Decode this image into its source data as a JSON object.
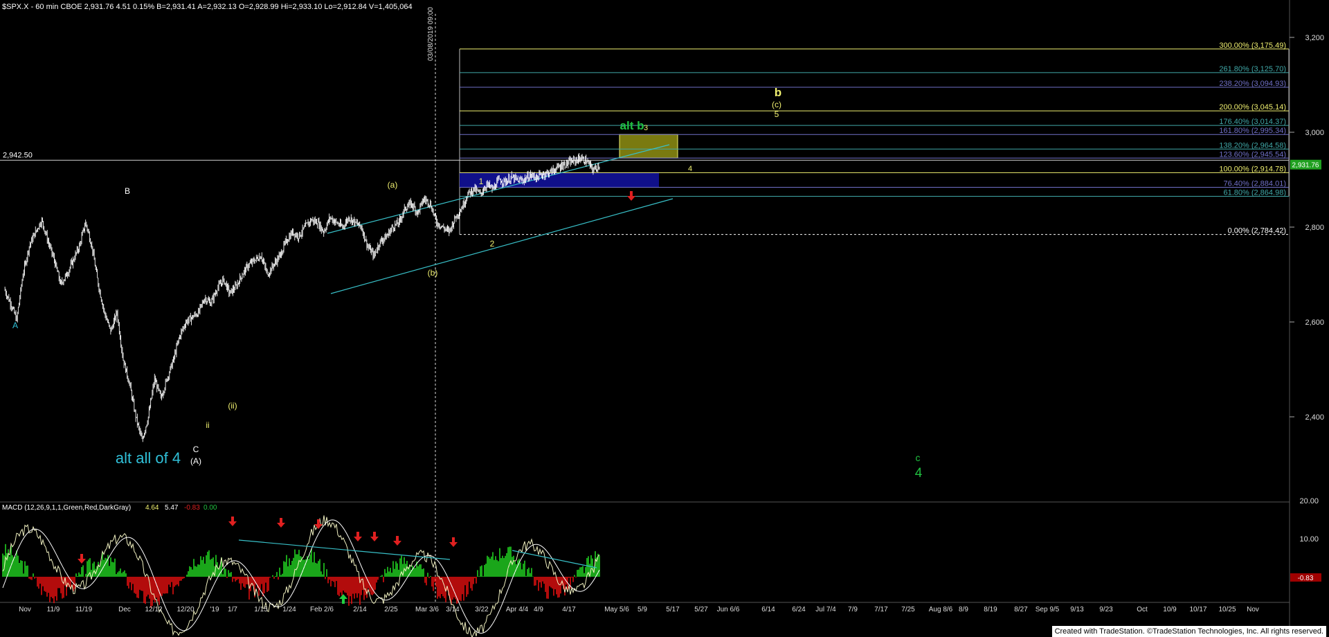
{
  "header": {
    "text": "$SPX.X - 60 min  CBOE  2,931.76  4.51  0.15%  B=2,931.41  A=2,932.13  O=2,928.99  Hi=2,933.10  Lo=2,912.84  V=1,405,064"
  },
  "footer": {
    "credit": "Created with TradeStation. ©TradeStation Technologies, Inc. All rights reserved."
  },
  "colors": {
    "background": "#000000",
    "candle": "#ffffff",
    "channel": "#38c0c8",
    "fib_yellow": "#f0f070",
    "fib_blue": "#7070c8",
    "fib_teal": "#40a8a8",
    "label_cyan": "#30c0d8",
    "label_green": "#20c040",
    "label_yellow": "#f0e040",
    "arrow_red": "#e02020",
    "arrow_green": "#20d040",
    "hist_up": "#20d020",
    "hist_down": "#e01010",
    "marker_green_bg": "#20a020"
  },
  "chart_data": {
    "type": "candlestick",
    "symbol": "$SPX.X",
    "interval": "60 min",
    "price_axis": {
      "ticks": [
        2400,
        2600,
        2800,
        3000,
        3200
      ],
      "tick_labels": [
        "2,400",
        "2,600",
        "2,800",
        "3,000",
        "3,200"
      ],
      "range": [
        2255,
        3295
      ]
    },
    "x_axis": {
      "labels": [
        "Nov",
        "11/9",
        "11/19",
        "Dec",
        "12/12",
        "12/20",
        "'19",
        "1/7",
        "1/15",
        "1/24",
        "Feb 2/6",
        "2/14",
        "2/25",
        "Mar 3/6",
        "3/14",
        "3/22",
        "Apr 4/4",
        "4/9",
        "4/17",
        "May 5/6",
        "5/9",
        "5/17",
        "5/27",
        "Jun 6/6",
        "6/14",
        "6/24",
        "Jul 7/4",
        "7/9",
        "7/17",
        "7/25",
        "Aug 8/6",
        "8/9",
        "8/19",
        "8/27",
        "Sep 9/5",
        "9/13",
        "9/23",
        "Oct",
        "10/9",
        "10/17",
        "10/25",
        "Nov"
      ],
      "last_bar_index": 95
    },
    "price_path": [
      [
        0,
        2670
      ],
      [
        1,
        2640
      ],
      [
        2,
        2605
      ],
      [
        3,
        2700
      ],
      [
        4,
        2760
      ],
      [
        5,
        2790
      ],
      [
        6,
        2815
      ],
      [
        7,
        2770
      ],
      [
        8,
        2730
      ],
      [
        9,
        2680
      ],
      [
        10,
        2700
      ],
      [
        11,
        2730
      ],
      [
        12,
        2760
      ],
      [
        13,
        2810
      ],
      [
        14,
        2760
      ],
      [
        15,
        2680
      ],
      [
        16,
        2620
      ],
      [
        17,
        2580
      ],
      [
        18,
        2620
      ],
      [
        19,
        2520
      ],
      [
        20,
        2470
      ],
      [
        21,
        2400
      ],
      [
        22,
        2350
      ],
      [
        23,
        2400
      ],
      [
        24,
        2480
      ],
      [
        25,
        2440
      ],
      [
        26,
        2480
      ],
      [
        27,
        2520
      ],
      [
        28,
        2570
      ],
      [
        29,
        2600
      ],
      [
        30,
        2610
      ],
      [
        31,
        2620
      ],
      [
        32,
        2650
      ],
      [
        33,
        2640
      ],
      [
        34,
        2670
      ],
      [
        35,
        2690
      ],
      [
        36,
        2660
      ],
      [
        37,
        2675
      ],
      [
        38,
        2700
      ],
      [
        39,
        2720
      ],
      [
        40,
        2730
      ],
      [
        41,
        2740
      ],
      [
        42,
        2700
      ],
      [
        43,
        2720
      ],
      [
        44,
        2740
      ],
      [
        45,
        2770
      ],
      [
        46,
        2790
      ],
      [
        47,
        2780
      ],
      [
        48,
        2800
      ],
      [
        49,
        2815
      ],
      [
        50,
        2810
      ],
      [
        51,
        2790
      ],
      [
        52,
        2820
      ],
      [
        53,
        2810
      ],
      [
        54,
        2800
      ],
      [
        55,
        2820
      ],
      [
        56,
        2810
      ],
      [
        57,
        2800
      ],
      [
        58,
        2760
      ],
      [
        59,
        2740
      ],
      [
        60,
        2770
      ],
      [
        61,
        2780
      ],
      [
        62,
        2800
      ],
      [
        63,
        2810
      ],
      [
        64,
        2840
      ],
      [
        65,
        2850
      ],
      [
        66,
        2830
      ],
      [
        67,
        2860
      ],
      [
        68,
        2850
      ],
      [
        69,
        2810
      ],
      [
        70,
        2800
      ],
      [
        71,
        2790
      ],
      [
        72,
        2820
      ],
      [
        73,
        2840
      ],
      [
        74,
        2870
      ],
      [
        75,
        2880
      ],
      [
        76,
        2870
      ],
      [
        77,
        2890
      ],
      [
        78,
        2880
      ],
      [
        79,
        2900
      ],
      [
        80,
        2895
      ],
      [
        81,
        2905
      ],
      [
        82,
        2898
      ],
      [
        83,
        2900
      ],
      [
        84,
        2910
      ],
      [
        85,
        2905
      ],
      [
        86,
        2912
      ],
      [
        87,
        2915
      ],
      [
        88,
        2922
      ],
      [
        89,
        2930
      ],
      [
        90,
        2935
      ],
      [
        91,
        2940
      ],
      [
        92,
        2945
      ],
      [
        93,
        2938
      ],
      [
        94,
        2920
      ],
      [
        95,
        2931
      ]
    ],
    "last_price": "2,931.76",
    "reference_line": {
      "value": 2942.5,
      "label": "2,942.50"
    },
    "fib_levels": [
      {
        "pct": "300.00%",
        "value": 3175.49,
        "label": "300.00% (3,175.49)",
        "color": "yellow"
      },
      {
        "pct": "261.80%",
        "value": 3125.7,
        "label": "261.80% (3,125.70)",
        "color": "teal"
      },
      {
        "pct": "238.20%",
        "value": 3094.93,
        "label": "238.20% (3,094.93)",
        "color": "blue"
      },
      {
        "pct": "200.00%",
        "value": 3045.14,
        "label": "200.00% (3,045.14)",
        "color": "yellow"
      },
      {
        "pct": "176.40%",
        "value": 3014.37,
        "label": "176.40% (3,014.37)",
        "color": "teal"
      },
      {
        "pct": "161.80%",
        "value": 2995.34,
        "label": "161.80% (2,995.34)",
        "color": "blue"
      },
      {
        "pct": "138.20%",
        "value": 2964.58,
        "label": "138.20% (2,964.58)",
        "color": "teal"
      },
      {
        "pct": "123.60%",
        "value": 2945.54,
        "label": "123.60% (2,945.54)",
        "color": "blue"
      },
      {
        "pct": "100.00%",
        "value": 2914.78,
        "label": "100.00% (2,914.78)",
        "color": "yellow"
      },
      {
        "pct": "76.40%",
        "value": 2884.01,
        "label": "76.40% (2,884.01)",
        "color": "blue"
      },
      {
        "pct": "61.80%",
        "value": 2864.98,
        "label": "61.80% (2,864.98)",
        "color": "teal"
      },
      {
        "pct": "0.00%",
        "value": 2784.42,
        "label": "0.00% (2,784.42)",
        "color": "white"
      }
    ],
    "vertical_marker": {
      "text": "03/08/2019 09:00"
    },
    "wave_labels": [
      {
        "text": "A",
        "color": "cyan"
      },
      {
        "text": "B",
        "color": "white"
      },
      {
        "text": "C",
        "color": "white"
      },
      {
        "text": "(A)",
        "color": "white"
      },
      {
        "text": "ii",
        "color": "yellow"
      },
      {
        "text": "(ii)",
        "color": "yellow"
      },
      {
        "text": "(a)",
        "color": "yellow"
      },
      {
        "text": "(b)",
        "color": "yellow"
      },
      {
        "text": "1",
        "color": "yellow"
      },
      {
        "text": "2",
        "color": "yellow"
      },
      {
        "text": "3",
        "color": "yellow"
      },
      {
        "text": "4",
        "color": "yellow"
      },
      {
        "text": "5",
        "color": "yellow"
      },
      {
        "text": "(c)",
        "color": "yellow"
      },
      {
        "text": "b",
        "color": "yellow"
      },
      {
        "text": "alt b",
        "color": "green"
      },
      {
        "text": "alt all of 4",
        "color": "cyan"
      },
      {
        "text": "c",
        "color": "green"
      },
      {
        "text": "4",
        "color": "green"
      }
    ],
    "macd": {
      "label": "MACD (12,26,9,1,1,Green,Red,DarkGray)",
      "values": [
        "4.64",
        "5.47",
        "-0.83",
        "0.00"
      ],
      "axis_ticks": [
        "20.00",
        "10.00"
      ],
      "last_value": "-0.83"
    }
  }
}
